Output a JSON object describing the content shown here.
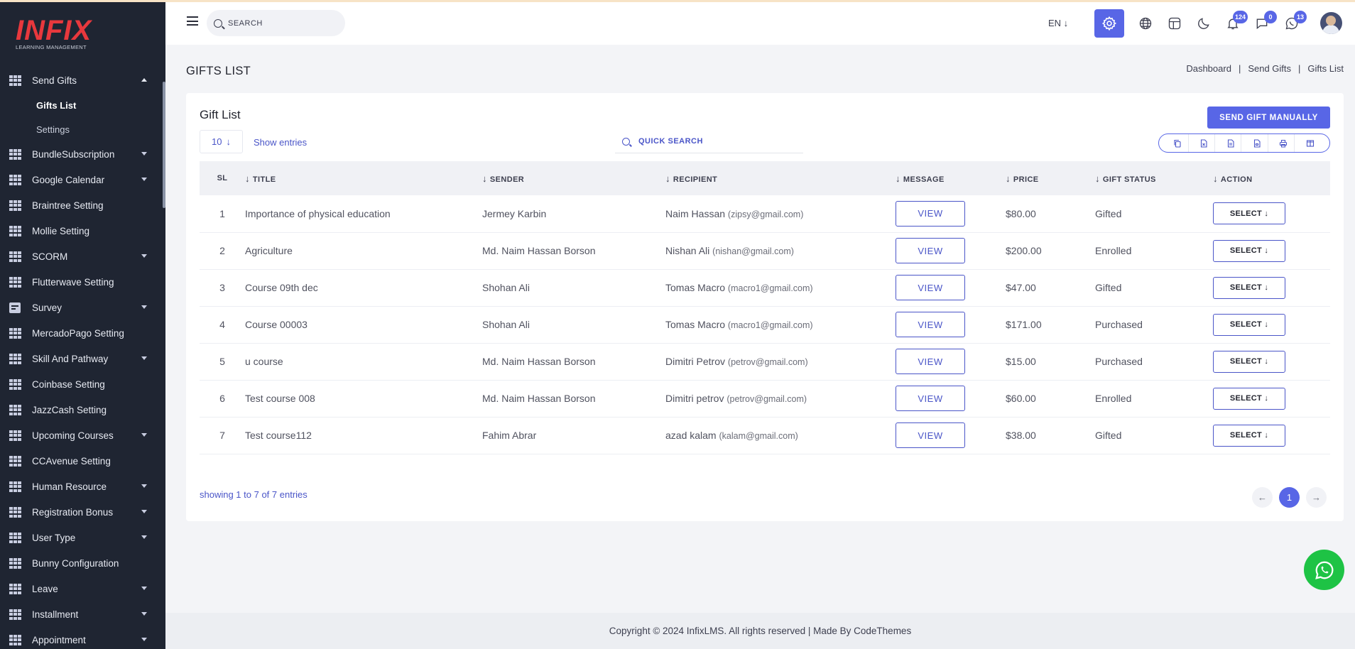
{
  "brand": {
    "logo": "INFIX",
    "tagline": "LEARNING MANAGEMENT"
  },
  "sidebar": {
    "items": [
      {
        "label": "Send Gifts",
        "expanded": true,
        "sub": [
          {
            "label": "Gifts List",
            "active": true
          },
          {
            "label": "Settings"
          }
        ]
      },
      {
        "label": "BundleSubscription",
        "caret": true
      },
      {
        "label": "Google Calendar",
        "caret": true
      },
      {
        "label": "Braintree Setting"
      },
      {
        "label": "Mollie Setting"
      },
      {
        "label": "SCORM",
        "caret": true
      },
      {
        "label": "Flutterwave Setting"
      },
      {
        "label": "Survey",
        "caret": true,
        "icon": "survey-icon"
      },
      {
        "label": "MercadoPago Setting"
      },
      {
        "label": "Skill And Pathway",
        "caret": true
      },
      {
        "label": "Coinbase Setting"
      },
      {
        "label": "JazzCash Setting"
      },
      {
        "label": "Upcoming Courses",
        "caret": true
      },
      {
        "label": "CCAvenue Setting"
      },
      {
        "label": "Human Resource",
        "caret": true
      },
      {
        "label": "Registration Bonus",
        "caret": true
      },
      {
        "label": "User Type",
        "caret": true
      },
      {
        "label": "Bunny Configuration"
      },
      {
        "label": "Leave",
        "caret": true
      },
      {
        "label": "Installment",
        "caret": true
      },
      {
        "label": "Appointment",
        "caret": true
      }
    ]
  },
  "topbar": {
    "search_placeholder": "SEARCH",
    "language": "EN ↓",
    "notifications_count": "124",
    "messages_count": "0",
    "chat_count": "13",
    "accent": "#5866e6"
  },
  "page": {
    "title": "GIFTS LIST",
    "breadcrumb": [
      "Dashboard",
      "Send Gifts",
      "Gifts List"
    ]
  },
  "card": {
    "title": "Gift List",
    "send_button": "SEND GIFT MANUALLY",
    "entries_value": "10",
    "show_entries": "Show entries",
    "quick_search_placeholder": "QUICK SEARCH",
    "columns": [
      "SL",
      "TITLE",
      "SENDER",
      "RECIPIENT",
      "MESSAGE",
      "PRICE",
      "GIFT STATUS",
      "ACTION"
    ],
    "rows": [
      {
        "sl": "1",
        "title": "Importance of physical education",
        "sender": "Jermey Karbin",
        "recipient": "Naim Hassan",
        "email": "(zipsy@gmail.com)",
        "message": "VIEW",
        "price": "$80.00",
        "status": "Gifted",
        "action": "SELECT ↓"
      },
      {
        "sl": "2",
        "title": "Agriculture",
        "sender": "Md. Naim Hassan Borson",
        "recipient": "Nishan Ali",
        "email": "(nishan@gmail.com)",
        "message": "VIEW",
        "price": "$200.00",
        "status": "Enrolled",
        "action": "SELECT ↓"
      },
      {
        "sl": "3",
        "title": "Course 09th dec",
        "sender": "Shohan Ali",
        "recipient": "Tomas Macro",
        "email": "(macro1@gmail.com)",
        "message": "VIEW",
        "price": "$47.00",
        "status": "Gifted",
        "action": "SELECT ↓"
      },
      {
        "sl": "4",
        "title": "Course 00003",
        "sender": "Shohan Ali",
        "recipient": "Tomas Macro",
        "email": "(macro1@gmail.com)",
        "message": "VIEW",
        "price": "$171.00",
        "status": "Purchased",
        "action": "SELECT ↓"
      },
      {
        "sl": "5",
        "title": "u course",
        "sender": "Md. Naim Hassan Borson",
        "recipient": "Dimitri Petrov",
        "email": "(petrov@gmail.com)",
        "message": "VIEW",
        "price": "$15.00",
        "status": "Purchased",
        "action": "SELECT ↓"
      },
      {
        "sl": "6",
        "title": "Test course 008",
        "sender": "Md. Naim Hassan Borson",
        "recipient": "Dimitri petrov",
        "email": "(petrov@gmail.com)",
        "message": "VIEW",
        "price": "$60.00",
        "status": "Enrolled",
        "action": "SELECT ↓"
      },
      {
        "sl": "7",
        "title": "Test course112",
        "sender": "Fahim Abrar",
        "recipient": "azad kalam",
        "email": "(kalam@gmail.com)",
        "message": "VIEW",
        "price": "$38.00",
        "status": "Gifted",
        "action": "SELECT ↓"
      }
    ],
    "showing": "showing 1 to 7 of 7 entries",
    "current_page": "1"
  },
  "footer": {
    "text": "Copyright © 2024 InfixLMS. All rights reserved | Made By CodeThemes"
  }
}
